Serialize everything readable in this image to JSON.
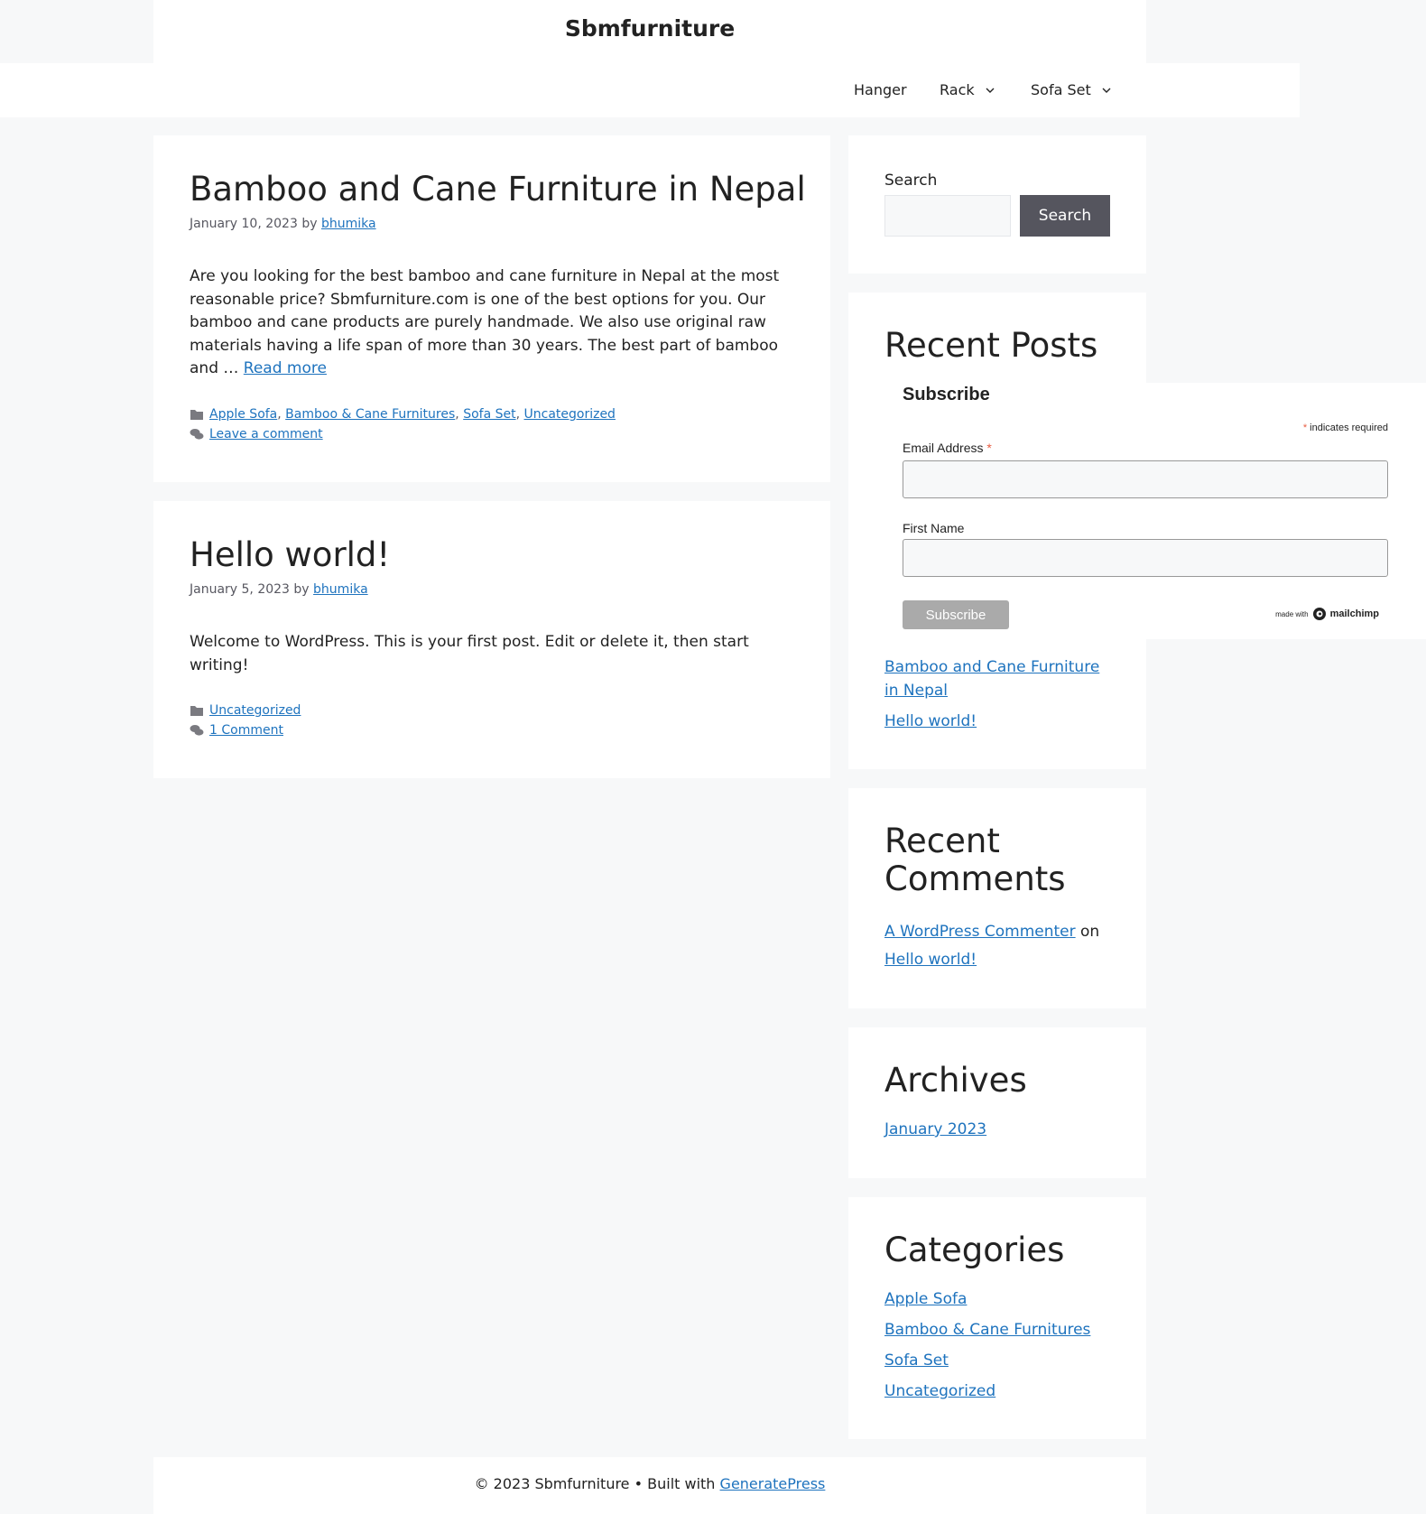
{
  "header": {
    "site_title": "Sbmfurniture"
  },
  "nav": {
    "items": [
      {
        "label": "Hanger",
        "has_submenu": false
      },
      {
        "label": "Rack",
        "has_submenu": true
      },
      {
        "label": "Sofa Set",
        "has_submenu": true
      }
    ]
  },
  "posts": [
    {
      "title": "Bamboo and Cane Furniture in Nepal",
      "date": "January 10, 2023",
      "by": "by",
      "author": "bhumika",
      "excerpt": "Are you looking for the best bamboo and cane furniture in Nepal at the most reasonable price? Sbmfurniture.com is one of the best options for you. Our bamboo and cane products are purely handmade. We also use original raw materials having a life span of more than 30 years. The best part of bamboo and …",
      "read_more": "Read more",
      "categories": [
        "Apple Sofa",
        "Bamboo & Cane Furnitures",
        "Sofa Set",
        "Uncategorized"
      ],
      "comments_link": "Leave a comment"
    },
    {
      "title": "Hello world!",
      "date": "January 5, 2023",
      "by": "by",
      "author": "bhumika",
      "excerpt": "Welcome to WordPress. This is your first post. Edit or delete it, then start writing!",
      "categories": [
        "Uncategorized"
      ],
      "comments_link": "1 Comment"
    }
  ],
  "sidebar": {
    "search": {
      "label": "Search",
      "button": "Search",
      "value": ""
    },
    "recent_posts": {
      "title": "Recent Posts",
      "items": [
        "Bamboo and Cane Furniture in Nepal",
        "Hello world!"
      ]
    },
    "recent_comments": {
      "title": "Recent Comments",
      "author": "A WordPress Commenter",
      "on": "on",
      "post": "Hello world!"
    },
    "archives": {
      "title": "Archives",
      "items": [
        "January 2023"
      ]
    },
    "categories": {
      "title": "Categories",
      "items": [
        "Apple Sofa",
        "Bamboo & Cane Furnitures",
        "Sofa Set",
        "Uncategorized"
      ]
    }
  },
  "mailchimp": {
    "title": "Subscribe",
    "required_mark": "*",
    "required_note": "indicates required",
    "email_label": "Email Address",
    "email_value": "",
    "first_name_label": "First Name",
    "first_name_value": "",
    "submit_label": "Subscribe",
    "badge_small": "made with",
    "badge_brand": "mailchimp"
  },
  "footer": {
    "copyright": "© 2023 Sbmfurniture • Built with",
    "theme_link": "GeneratePress"
  },
  "colors": {
    "link": "#1e73be",
    "button": "#55555e",
    "background": "#f7f8f9",
    "required": "#e85c41"
  },
  "icons": {
    "category": "folder-icon",
    "comments": "comments-icon",
    "submenu": "chevron-down-icon",
    "brand": "mailchimp-logo-icon"
  }
}
